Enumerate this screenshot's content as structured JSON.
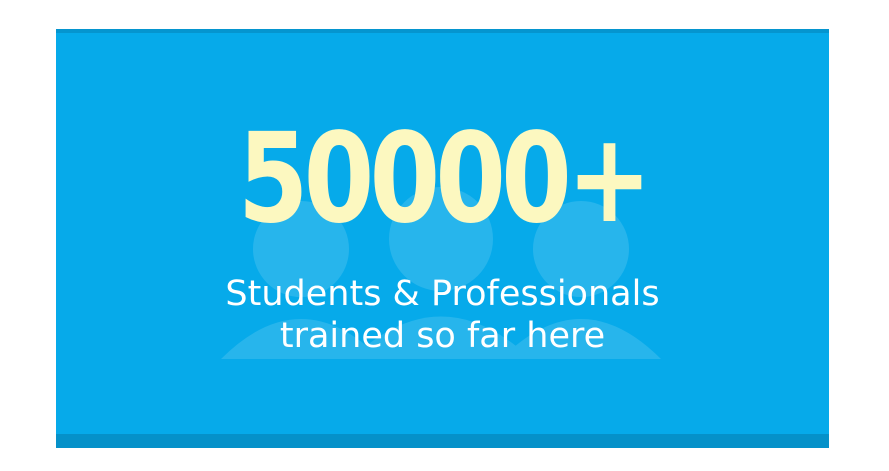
{
  "stat": {
    "value": "50000+",
    "caption_line1": "Students & Professionals",
    "caption_line2": "trained so far here"
  },
  "colors": {
    "card_background": "#06aaea",
    "value_text": "#fcf8c0",
    "caption_text": "#ffffff"
  },
  "icons": {
    "watermark": "students-group-icon"
  }
}
